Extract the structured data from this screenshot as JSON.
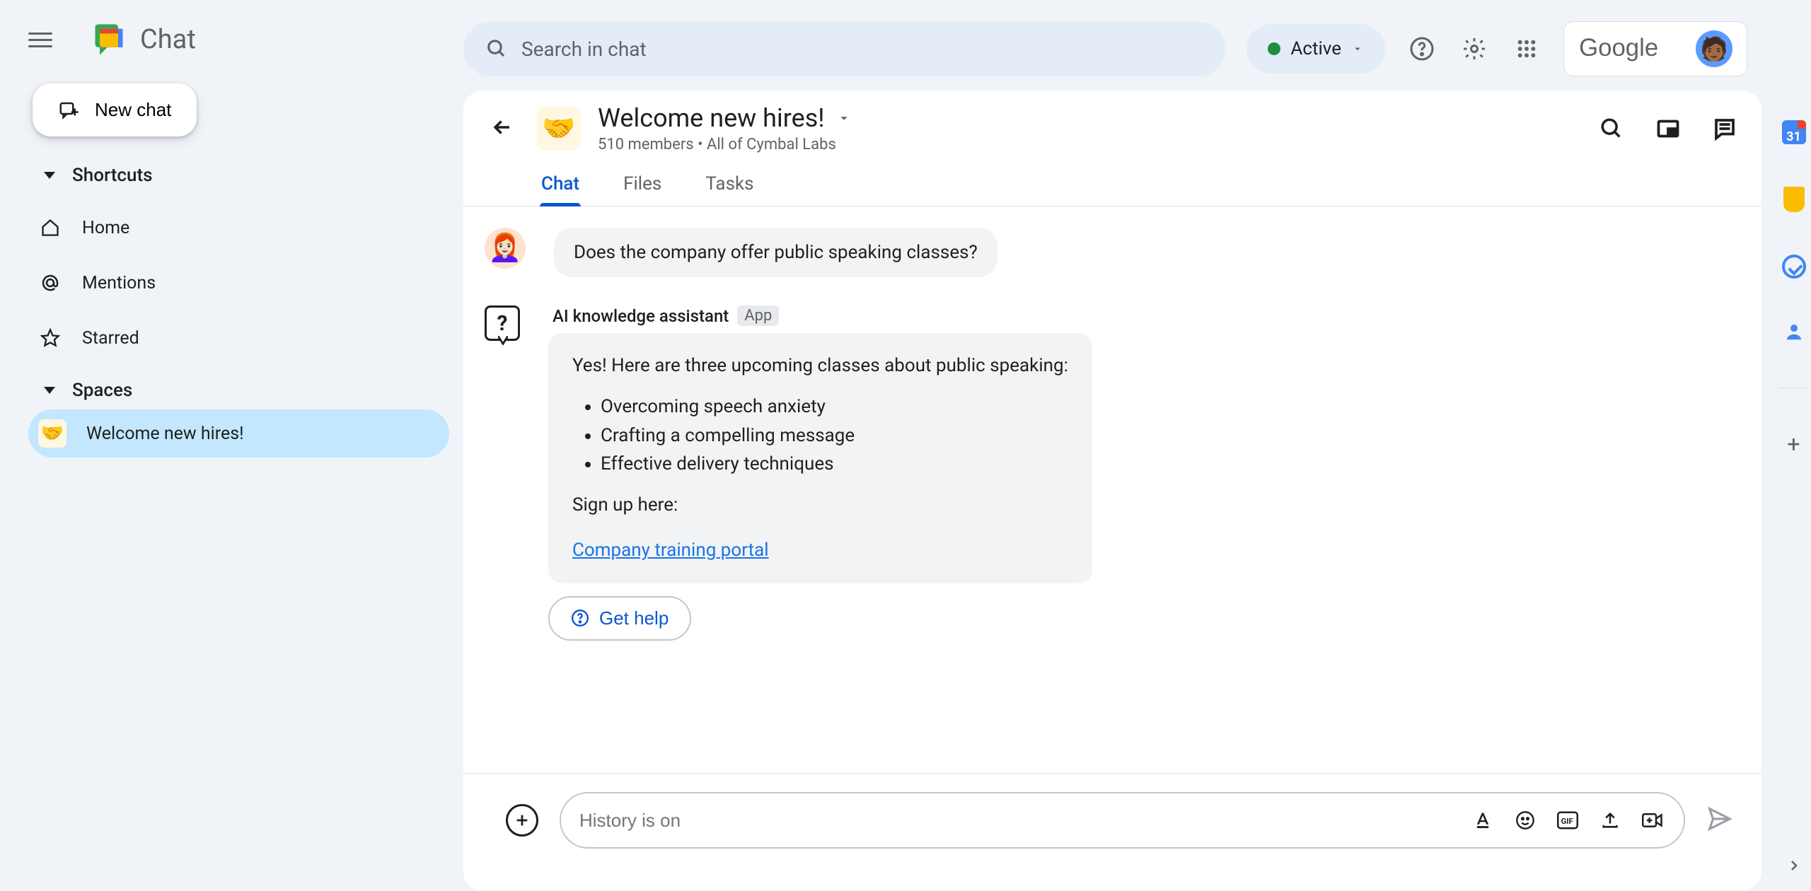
{
  "app": {
    "name": "Chat"
  },
  "newChat": {
    "label": "New chat"
  },
  "sidebar": {
    "shortcuts": {
      "header": "Shortcuts",
      "items": [
        {
          "label": "Home"
        },
        {
          "label": "Mentions"
        },
        {
          "label": "Starred"
        }
      ]
    },
    "spaces": {
      "header": "Spaces",
      "items": [
        {
          "label": "Welcome new hires!"
        }
      ]
    }
  },
  "search": {
    "placeholder": "Search in chat"
  },
  "status": {
    "label": "Active"
  },
  "google": {
    "label": "Google"
  },
  "room": {
    "title": "Welcome new hires!",
    "sub": "510 members  •  All of Cymbal Labs",
    "tabs": [
      {
        "label": "Chat"
      },
      {
        "label": "Files"
      },
      {
        "label": "Tasks"
      }
    ]
  },
  "messages": {
    "user": {
      "text": "Does the company offer public speaking classes?"
    },
    "ai": {
      "name": "AI knowledge assistant",
      "badge": "App",
      "intro": "Yes! Here are three upcoming classes about public speaking:",
      "items": [
        "Overcoming speech anxiety",
        "Crafting a compelling message",
        "Effective delivery techniques"
      ],
      "footer": "Sign up here:",
      "link": "Company training portal",
      "getHelp": "Get help"
    }
  },
  "compose": {
    "placeholder": "History is on"
  },
  "calendar": {
    "day": "31"
  }
}
